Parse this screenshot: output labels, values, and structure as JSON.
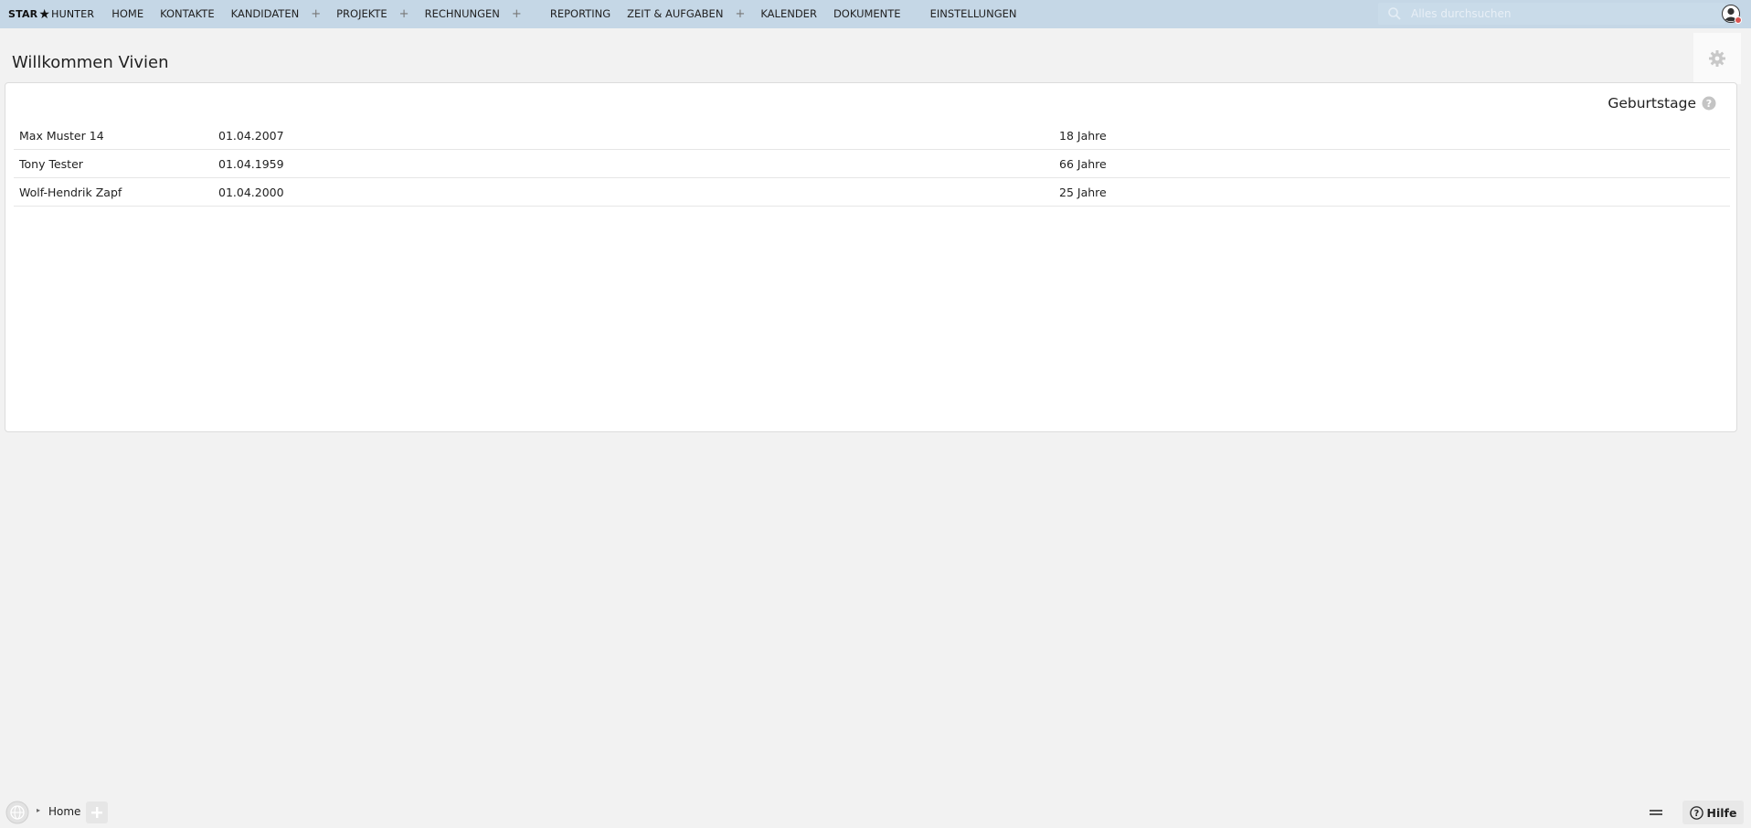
{
  "brand": {
    "part1": "STAR",
    "part2": "HUNTER"
  },
  "nav": {
    "home": "HOME",
    "kontakte": "KONTAKTE",
    "kandidaten": "KANDIDATEN",
    "projekte": "PROJEKTE",
    "rechnungen": "RECHNUNGEN",
    "reporting": "REPORTING",
    "zeit": "ZEIT & AUFGABEN",
    "kalender": "KALENDER",
    "dokumente": "DOKUMENTE",
    "einstellungen": "EINSTELLUNGEN",
    "plus": "+"
  },
  "search": {
    "placeholder": "Alles durchsuchen"
  },
  "page": {
    "title": "Willkommen Vivien"
  },
  "birthdays": {
    "title": "Geburtstage",
    "rows": [
      {
        "name": "Max Muster 14",
        "date": "01.04.2007",
        "age": "18 Jahre"
      },
      {
        "name": "Tony Tester",
        "date": "01.04.1959",
        "age": "66 Jahre"
      },
      {
        "name": "Wolf-Hendrik Zapf",
        "date": "01.04.2000",
        "age": "25 Jahre"
      }
    ]
  },
  "footer": {
    "crumb_arrow": "▸",
    "home": "Home",
    "help": "Hilfe"
  },
  "colors": {
    "topbar": "#c5d7e6",
    "background": "#f2f2f2",
    "notification": "#d9534f"
  },
  "icons": {
    "search": "search-icon",
    "avatar": "user-avatar-icon",
    "settings": "gear-icon",
    "help": "question-circle-icon",
    "globe": "globe-icon",
    "add": "plus-icon",
    "minimize": "minimize-icon"
  }
}
